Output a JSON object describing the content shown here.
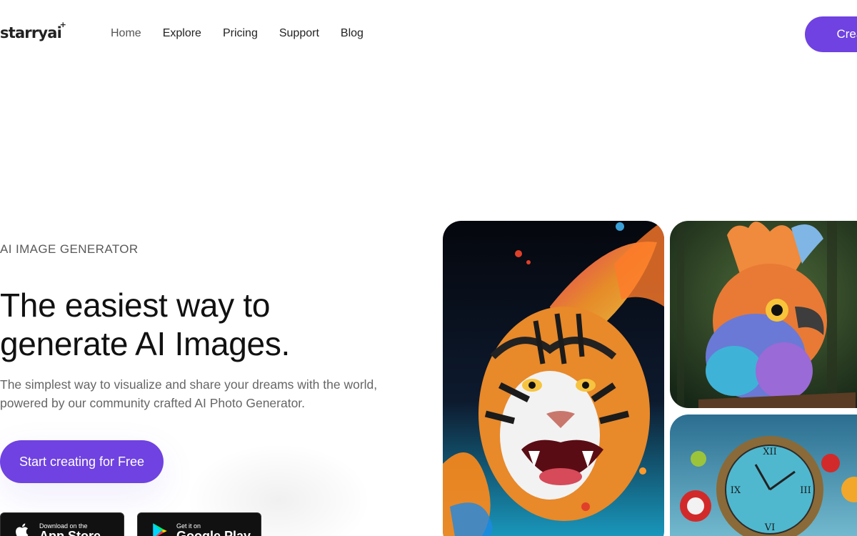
{
  "brand": {
    "name": "starryai",
    "spark": "+"
  },
  "nav": {
    "items": [
      {
        "label": "Home",
        "active": true
      },
      {
        "label": "Explore"
      },
      {
        "label": "Pricing"
      },
      {
        "label": "Support"
      },
      {
        "label": "Blog"
      }
    ],
    "cta_label": "Create"
  },
  "hero": {
    "eyebrow": "AI IMAGE GENERATOR",
    "headline_line1": "The easiest way to",
    "headline_line2": "generate AI Images.",
    "subtitle": "The simplest way to visualize and share your dreams with the world, powered by our community crafted AI Photo Generator.",
    "cta_label": "Start creating for Free"
  },
  "stores": {
    "apple": {
      "small": "Download on the",
      "big": "App Store",
      "icon": "apple-icon"
    },
    "google": {
      "small": "Get it on",
      "big": "Google Play",
      "icon": "google-play-icon"
    }
  },
  "gallery": [
    {
      "name": "tiger-image",
      "subject": "tiger"
    },
    {
      "name": "bird-image",
      "subject": "bird"
    },
    {
      "name": "clock-image",
      "subject": "clock"
    }
  ],
  "colors": {
    "accent": "#6f42e1",
    "text": "#111111",
    "muted": "#666666"
  }
}
